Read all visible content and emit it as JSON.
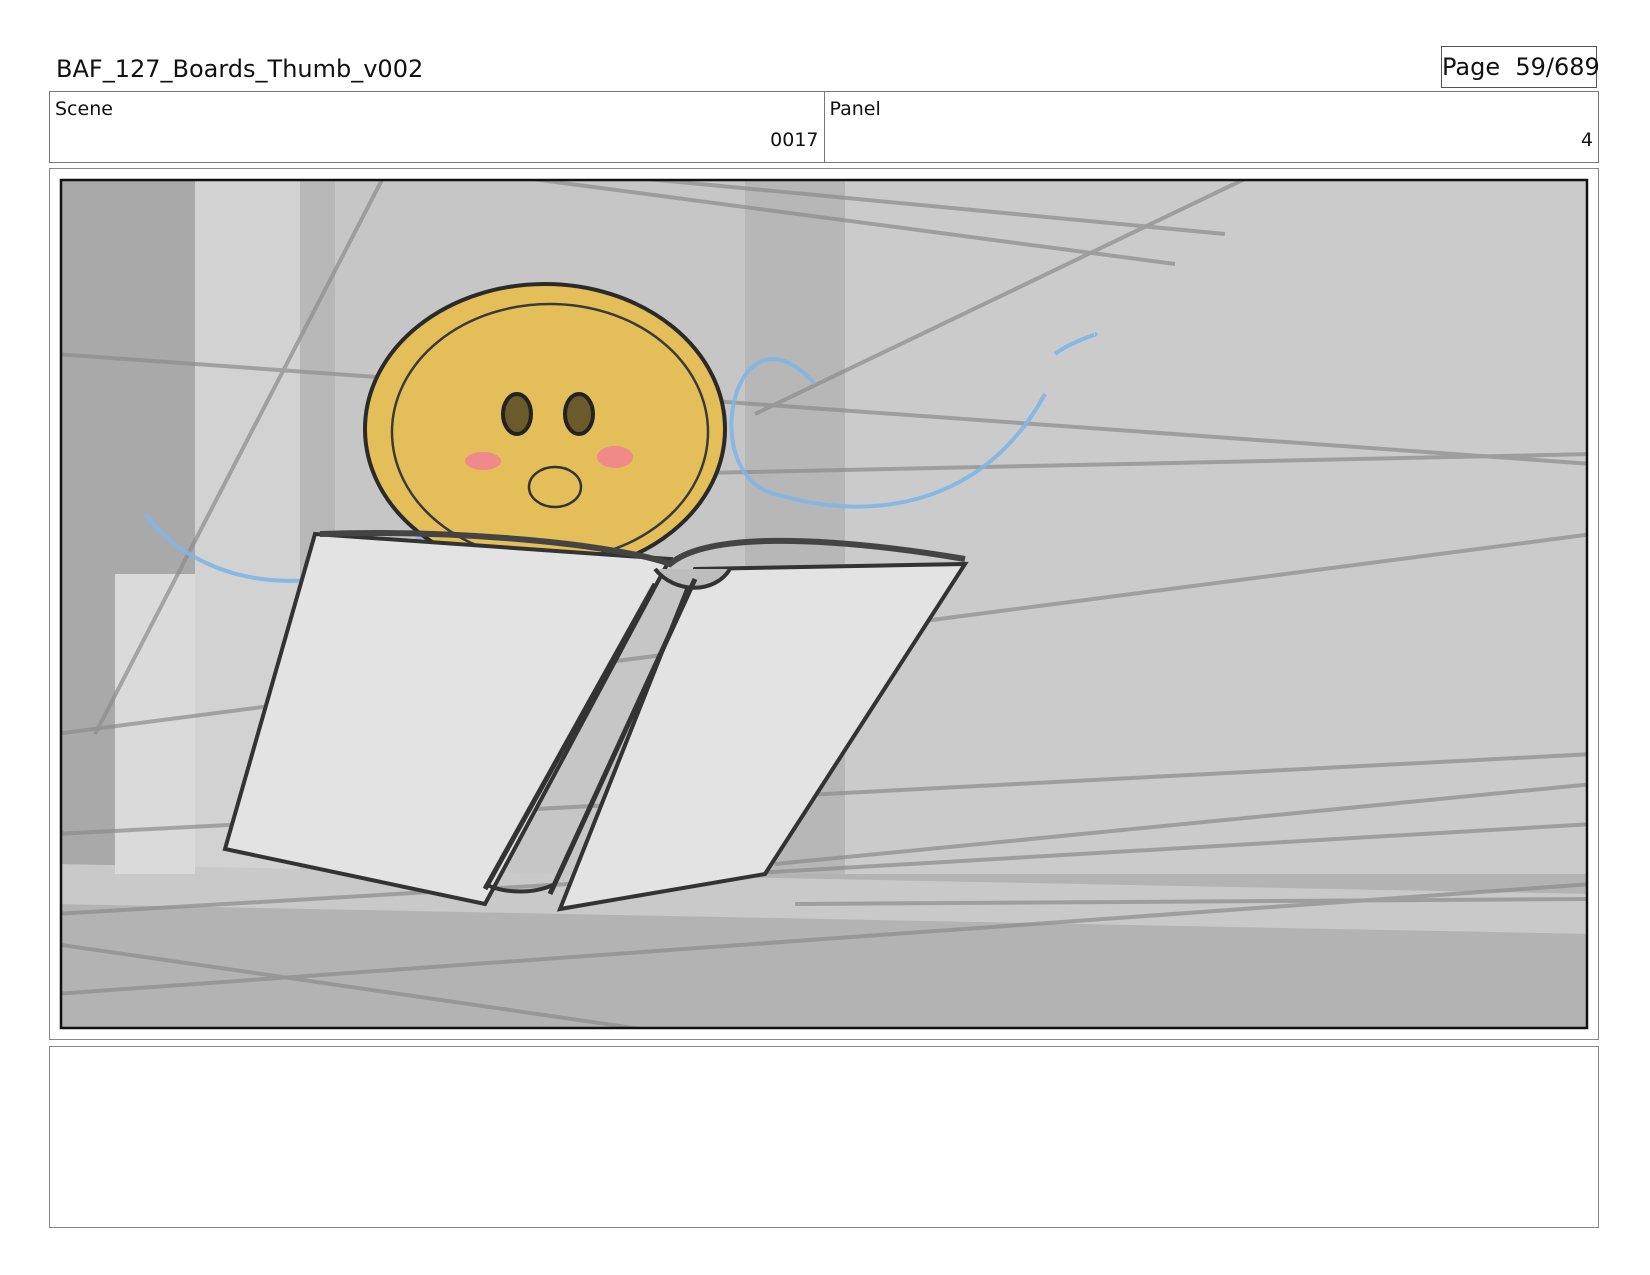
{
  "document": {
    "title": "BAF_127_Boards_Thumb_v002"
  },
  "page": {
    "label": "Page",
    "number": "59/689"
  },
  "scene": {
    "label": "Scene",
    "value": "0017"
  },
  "panel": {
    "label": "Panel",
    "value": "4"
  },
  "artwork": {
    "subject": "coin-character-reading-book-icon",
    "colors": {
      "background": "#c8c8c8",
      "coin": "#e6c05a",
      "coin_outline": "#2a2a2a",
      "cheeks": "#f08a8a",
      "wind_lines": "#7fb6e6",
      "book_pages": "#e6e6e6",
      "frame_border": "#111111"
    }
  },
  "notes": {
    "text": ""
  }
}
